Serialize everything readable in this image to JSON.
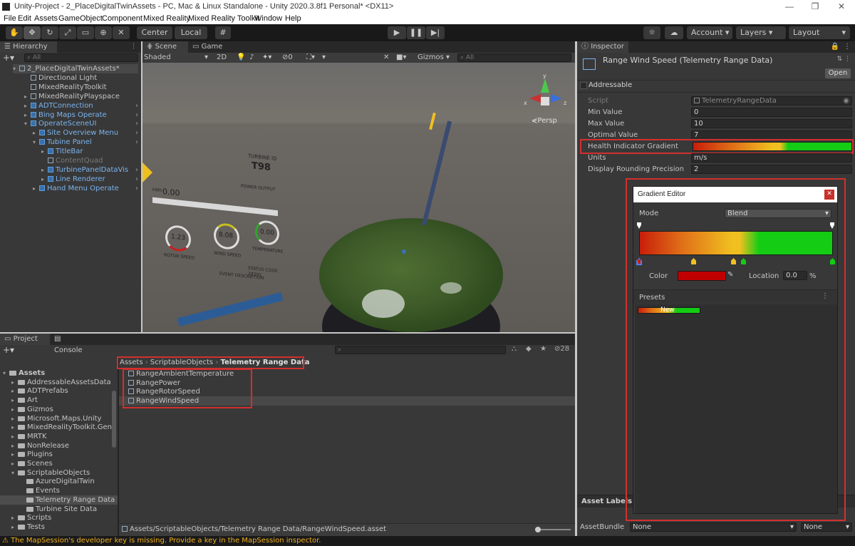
{
  "window": {
    "title": "Unity-Project - 2_PlaceDigitalTwinAssets - PC, Mac & Linux Standalone - Unity 2020.3.8f1 Personal* <DX11>",
    "controls": [
      "—",
      "❐",
      "✕"
    ]
  },
  "menu": [
    "File",
    "Edit",
    "Assets",
    "GameObject",
    "Component",
    "Mixed Reality",
    "Mixed Reality Toolkit",
    "Window",
    "Help"
  ],
  "toolbar": {
    "pivot_center": "Center",
    "pivot_local": "Local",
    "account": "Account",
    "layers": "Layers",
    "layout": "Layout"
  },
  "hierarchy": {
    "tab": "Hierarchy",
    "search_placeholder": "All",
    "items": [
      {
        "label": "2_PlaceDigitalTwinAssets*",
        "indent": 0
      },
      {
        "label": "Directional Light",
        "indent": 1
      },
      {
        "label": "MixedRealityToolkit",
        "indent": 1
      },
      {
        "label": "MixedRealityPlayspace",
        "indent": 1
      },
      {
        "label": "ADTConnection",
        "indent": 1
      },
      {
        "label": "Bing Maps Operate",
        "indent": 1
      },
      {
        "label": "OperateSceneUI",
        "indent": 1
      },
      {
        "label": "Site Overview Menu",
        "indent": 2
      },
      {
        "label": "Tubine Panel",
        "indent": 2
      },
      {
        "label": "TitleBar",
        "indent": 3
      },
      {
        "label": "ContentQuad",
        "indent": 3
      },
      {
        "label": "TurbinePanelDataVis",
        "indent": 3
      },
      {
        "label": "Line Renderer",
        "indent": 3
      },
      {
        "label": "Hand Menu Operate",
        "indent": 2
      }
    ]
  },
  "scene": {
    "tab_scene": "Scene",
    "tab_game": "Game",
    "shading": "Shaded",
    "mode_2d": "2D",
    "fx_count": "0",
    "gizmos": "Gizmos",
    "search_placeholder": "All",
    "persp": "Persp",
    "axis_y": "y",
    "axis_x": "x",
    "axis_z": "z",
    "panel_texts": [
      "TURBINE ID",
      "T98",
      "POWER OUTPUT",
      "0.00",
      "kWh",
      "TEMPERATURE",
      "0.00",
      "WIND SPEED",
      "8.08",
      "ROTOR SPEED",
      "1.23",
      "EVENT DESCRIPTION",
      "STATUS CODE",
      "28391"
    ]
  },
  "project": {
    "tab_project": "Project",
    "tab_console": "Console",
    "hidden_count": "28",
    "breadcrumb": [
      "Assets",
      "ScriptableObjects",
      "Telemetry Range Data"
    ],
    "tree": [
      {
        "label": "Assets",
        "indent": 0
      },
      {
        "label": "AddressableAssetsData",
        "indent": 1
      },
      {
        "label": "ADTPrefabs",
        "indent": 1
      },
      {
        "label": "Art",
        "indent": 1
      },
      {
        "label": "Gizmos",
        "indent": 1
      },
      {
        "label": "Microsoft.Maps.Unity",
        "indent": 1
      },
      {
        "label": "MixedRealityToolkit.Gen",
        "indent": 1
      },
      {
        "label": "MRTK",
        "indent": 1
      },
      {
        "label": "NonRelease",
        "indent": 1
      },
      {
        "label": "Plugins",
        "indent": 1
      },
      {
        "label": "Scenes",
        "indent": 1
      },
      {
        "label": "ScriptableObjects",
        "indent": 1
      },
      {
        "label": "AzureDigitalTwin",
        "indent": 2
      },
      {
        "label": "Events",
        "indent": 2
      },
      {
        "label": "Telemetry Range Data",
        "indent": 2
      },
      {
        "label": "Turbine Site Data",
        "indent": 2
      },
      {
        "label": "Scripts",
        "indent": 1
      },
      {
        "label": "Tests",
        "indent": 1
      }
    ],
    "files": [
      "RangeAmbientTemperature",
      "RangePower",
      "RangeRotorSpeed",
      "RangeWindSpeed"
    ],
    "footer_path": "Assets/ScriptableObjects/Telemetry Range Data/RangeWindSpeed.asset"
  },
  "inspector": {
    "tab": "Inspector",
    "object_name": "Range Wind Speed (Telemetry Range Data)",
    "open": "Open",
    "addressable": "Addressable",
    "fields": {
      "script_label": "Script",
      "script_value": "TelemetryRangeData",
      "min_label": "Min Value",
      "min_value": "0",
      "max_label": "Max Value",
      "max_value": "10",
      "opt_label": "Optimal Value",
      "opt_value": "7",
      "gradient_label": "Health Indicator Gradient",
      "units_label": "Units",
      "units_value": "m/s",
      "round_label": "Display Rounding Precision",
      "round_value": "2"
    },
    "asset_labels": "Asset Labels",
    "asset_bundle": "AssetBundle",
    "bundle_value": "None",
    "bundle_variant": "None"
  },
  "gradient_editor": {
    "title": "Gradient Editor",
    "mode_label": "Mode",
    "mode_value": "Blend",
    "color_label": "Color",
    "location_label": "Location",
    "location_value": "0.0",
    "percent": "%",
    "presets_label": "Presets",
    "preset_name": "New"
  },
  "status": {
    "message": "The MapSession's developer key is missing. Provide a key in the MapSession inspector."
  },
  "colors": {
    "highlight_red": "#d32f2f",
    "gradient_red": "#c81e0a",
    "gradient_yellow": "#f0c020",
    "gradient_green": "#14cc14"
  }
}
